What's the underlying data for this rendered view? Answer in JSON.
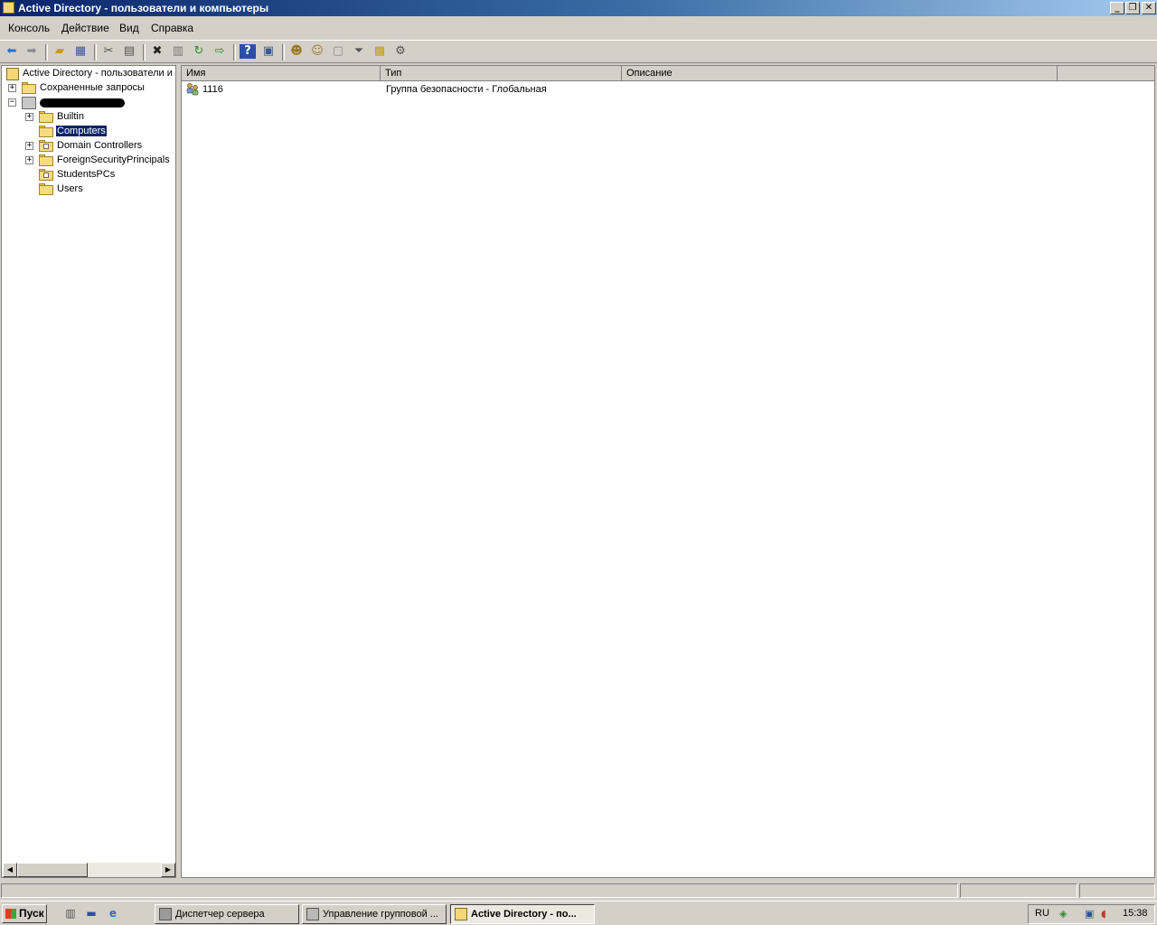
{
  "window": {
    "title": "Active Directory - пользователи и компьютеры",
    "controls": [
      "_",
      "❐",
      "✕"
    ]
  },
  "menu": {
    "items": [
      "Консоль",
      "Действие",
      "Вид",
      "Справка"
    ]
  },
  "toolbar": {
    "icons": [
      "back-arrow-icon",
      "forward-arrow-icon",
      "up-folder-icon",
      "show-hide-tree-icon",
      "cut-icon",
      "copy-icon",
      "delete-icon",
      "properties-icon",
      "refresh-icon",
      "export-list-icon",
      "help-icon",
      "show-hide-action-pane-icon",
      "new-user-icon",
      "new-group-icon",
      "new-ou-icon",
      "filter-icon",
      "find-icon",
      "add-to-group-icon"
    ]
  },
  "tree": {
    "root": "Active Directory - пользователи и",
    "saved_queries": "Сохраненные запросы",
    "domain": "",
    "children": {
      "builtin": "Builtin",
      "computers": "Computers",
      "domain_controllers": "Domain Controllers",
      "foreign_security_principals": "ForeignSecurityPrincipals",
      "students_pcs": "StudentsPCs",
      "users": "Users"
    },
    "selected": "Computers"
  },
  "list": {
    "columns": [
      "Имя",
      "Тип",
      "Описание"
    ],
    "rows": [
      {
        "name": "1116",
        "type": "Группа безопасности - Глобальная",
        "description": "",
        "icon": "security-group-icon"
      }
    ]
  },
  "taskbar": {
    "start": "Пуск",
    "quick_launch": [
      "server-manager-icon",
      "show-desktop-icon",
      "internet-explorer-icon"
    ],
    "tasks": [
      {
        "label": "Диспетчер сервера",
        "active": false
      },
      {
        "label": "Управление групповой ...",
        "active": false
      },
      {
        "label": "Active Directory - по...",
        "active": true
      }
    ],
    "tray": {
      "language": "RU",
      "time": "15:38",
      "icons": [
        "security-shield-icon",
        "network-icon",
        "volume-muted-icon"
      ]
    }
  },
  "colors": {
    "title_gradient_start": "#0a246a",
    "title_gradient_end": "#a6caf0",
    "selection": "#0a246a",
    "face": "#d4d0c8"
  }
}
